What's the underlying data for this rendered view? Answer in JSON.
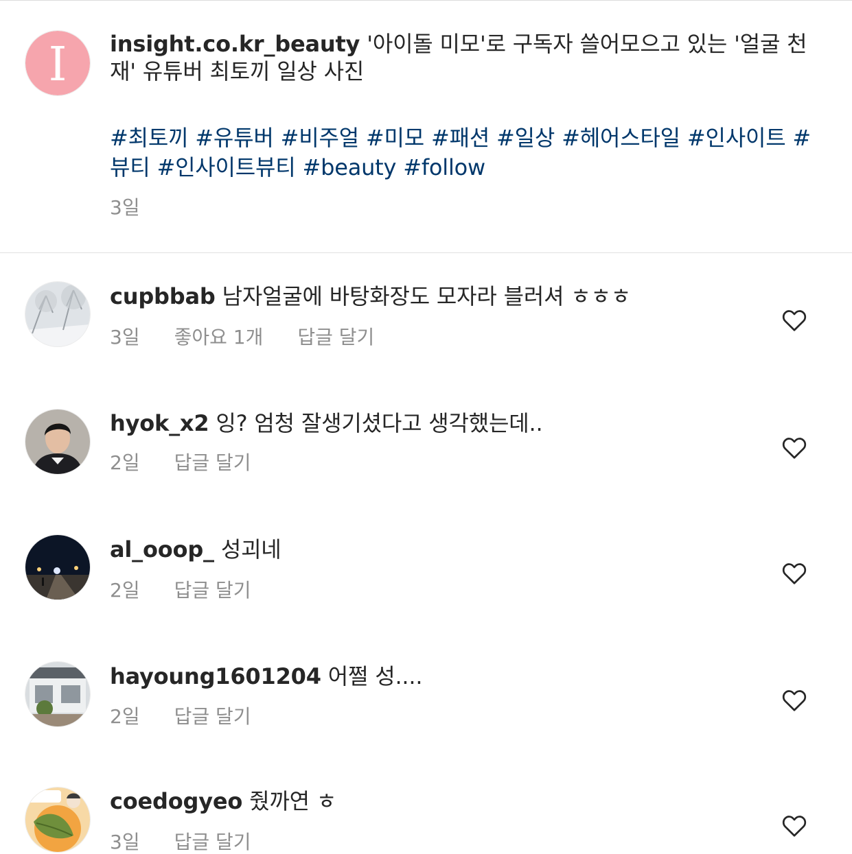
{
  "post": {
    "username": "insight.co.kr_beauty",
    "caption": "'아이돌 미모'로 구독자 쓸어모으고 있는 '얼굴 천재' 유튜버 최토끼 일상 사진",
    "hashtags": "#최토끼 #유튜버 #비주얼 #미모 #패션 #일상 #헤어스타일 #인사이트 #뷰티 #인사이트뷰티 #beauty #follow",
    "time": "3일",
    "avatar_letter": "I"
  },
  "comments": [
    {
      "username": "cupbbab",
      "text": "남자얼굴에 바탕화장도 모자라 블러셔 ㅎㅎㅎ",
      "time": "3일",
      "likes": "좋아요 1개",
      "reply": "답글 달기"
    },
    {
      "username": "hyok_x2",
      "text": "잉? 엄청 잘생기셨다고 생각했는데..",
      "time": "2일",
      "reply": "답글 달기"
    },
    {
      "username": "al_ooop_",
      "text": "성괴네",
      "time": "2일",
      "reply": "답글 달기"
    },
    {
      "username": "hayoung1601204",
      "text": "어쩔 성....",
      "time": "2일",
      "reply": "답글 달기"
    },
    {
      "username": "coedogyeo",
      "text": "줬까연 ㅎ",
      "time": "3일",
      "reply": "답글 달기"
    }
  ],
  "colors": {
    "hashtag": "#00376b",
    "meta_gray": "#8e8e8e",
    "avatar_pink": "#f6a5ad"
  }
}
